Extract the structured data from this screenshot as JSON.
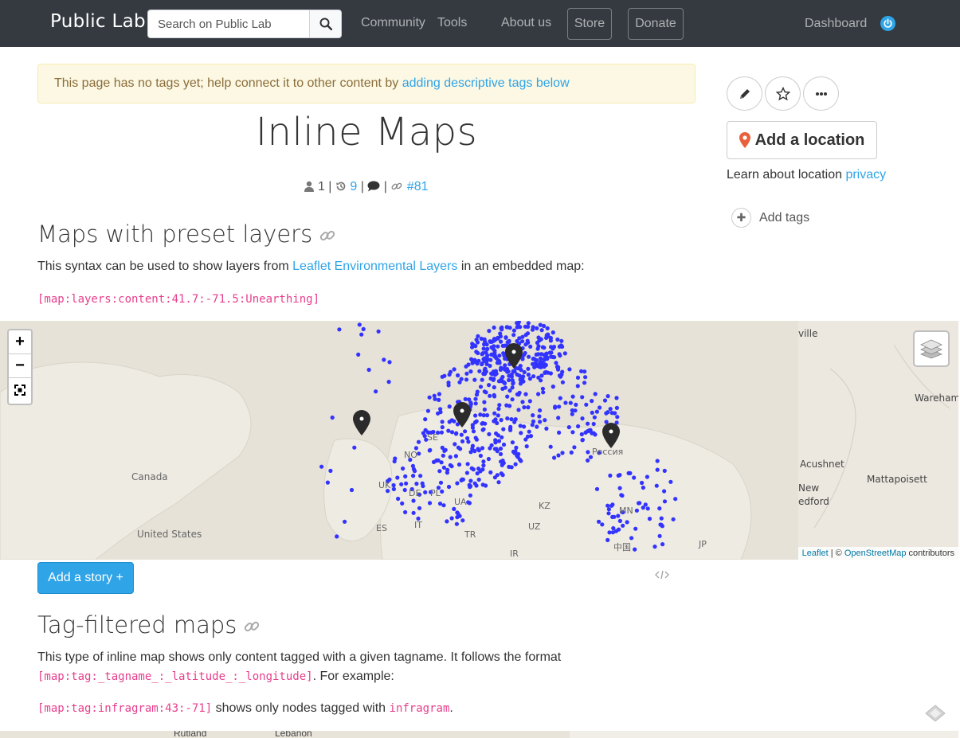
{
  "navbar": {
    "brand": "Public Lab",
    "search_placeholder": "Search on Public Lab",
    "links": [
      "Community",
      "Tools",
      "About us"
    ],
    "store": "Store",
    "donate": "Donate",
    "dashboard": "Dashboard"
  },
  "alert": {
    "text": "This page has no tags yet; help connect it to other content by ",
    "link": "adding descriptive tags below"
  },
  "page": {
    "title": "Inline Maps",
    "meta": {
      "authors": "1",
      "revisions": "9",
      "node_id": "#81"
    }
  },
  "section1": {
    "heading": "Maps with preset layers",
    "text_before": "This syntax can be used to show layers from ",
    "link": "Leaflet Environmental Layers",
    "text_after": " in an embedded map:",
    "code": "[map:layers:content:41.7:-71.5:Unearthing]"
  },
  "map": {
    "zoom_in": "+",
    "zoom_out": "−",
    "labels": [
      "Canada",
      "United States",
      "UK",
      "NO",
      "SE",
      "DE",
      "PL",
      "UA",
      "ES",
      "IT",
      "TR",
      "KZ",
      "UZ",
      "MN",
      "JP",
      "Россия",
      "IR",
      "中国",
      "ville",
      "Wareham",
      "Acushnet",
      "Mattapoisett",
      "New",
      "edford"
    ],
    "attribution_leaflet": "Leaflet",
    "attribution_sep": " | © ",
    "attribution_osm": "OpenStreetMap",
    "attribution_suffix": " contributors"
  },
  "add_story": "Add a story +",
  "section2": {
    "heading": "Tag-filtered maps",
    "text1": "This type of inline map shows only content tagged with a given tagname. It follows the format",
    "code1": "[map:tag:_tagname_:_latitude_:_longitude]",
    "text2": ". For example:",
    "code2": "[map:tag:infragram:43:-71]",
    "text3": " shows only nodes tagged with ",
    "code3": "infragram",
    "text4": "."
  },
  "map2": {
    "labels": [
      "Rutland",
      "Lebanon"
    ]
  },
  "sidebar": {
    "add_location": "Add a location",
    "learn_text": "Learn about location ",
    "learn_link": "privacy",
    "add_tags": "Add tags"
  },
  "colors": {
    "navbar": "#343a40",
    "accent": "#2fa4e7",
    "alert_bg": "#fcf8e3",
    "map_dot": "#3333ff"
  }
}
